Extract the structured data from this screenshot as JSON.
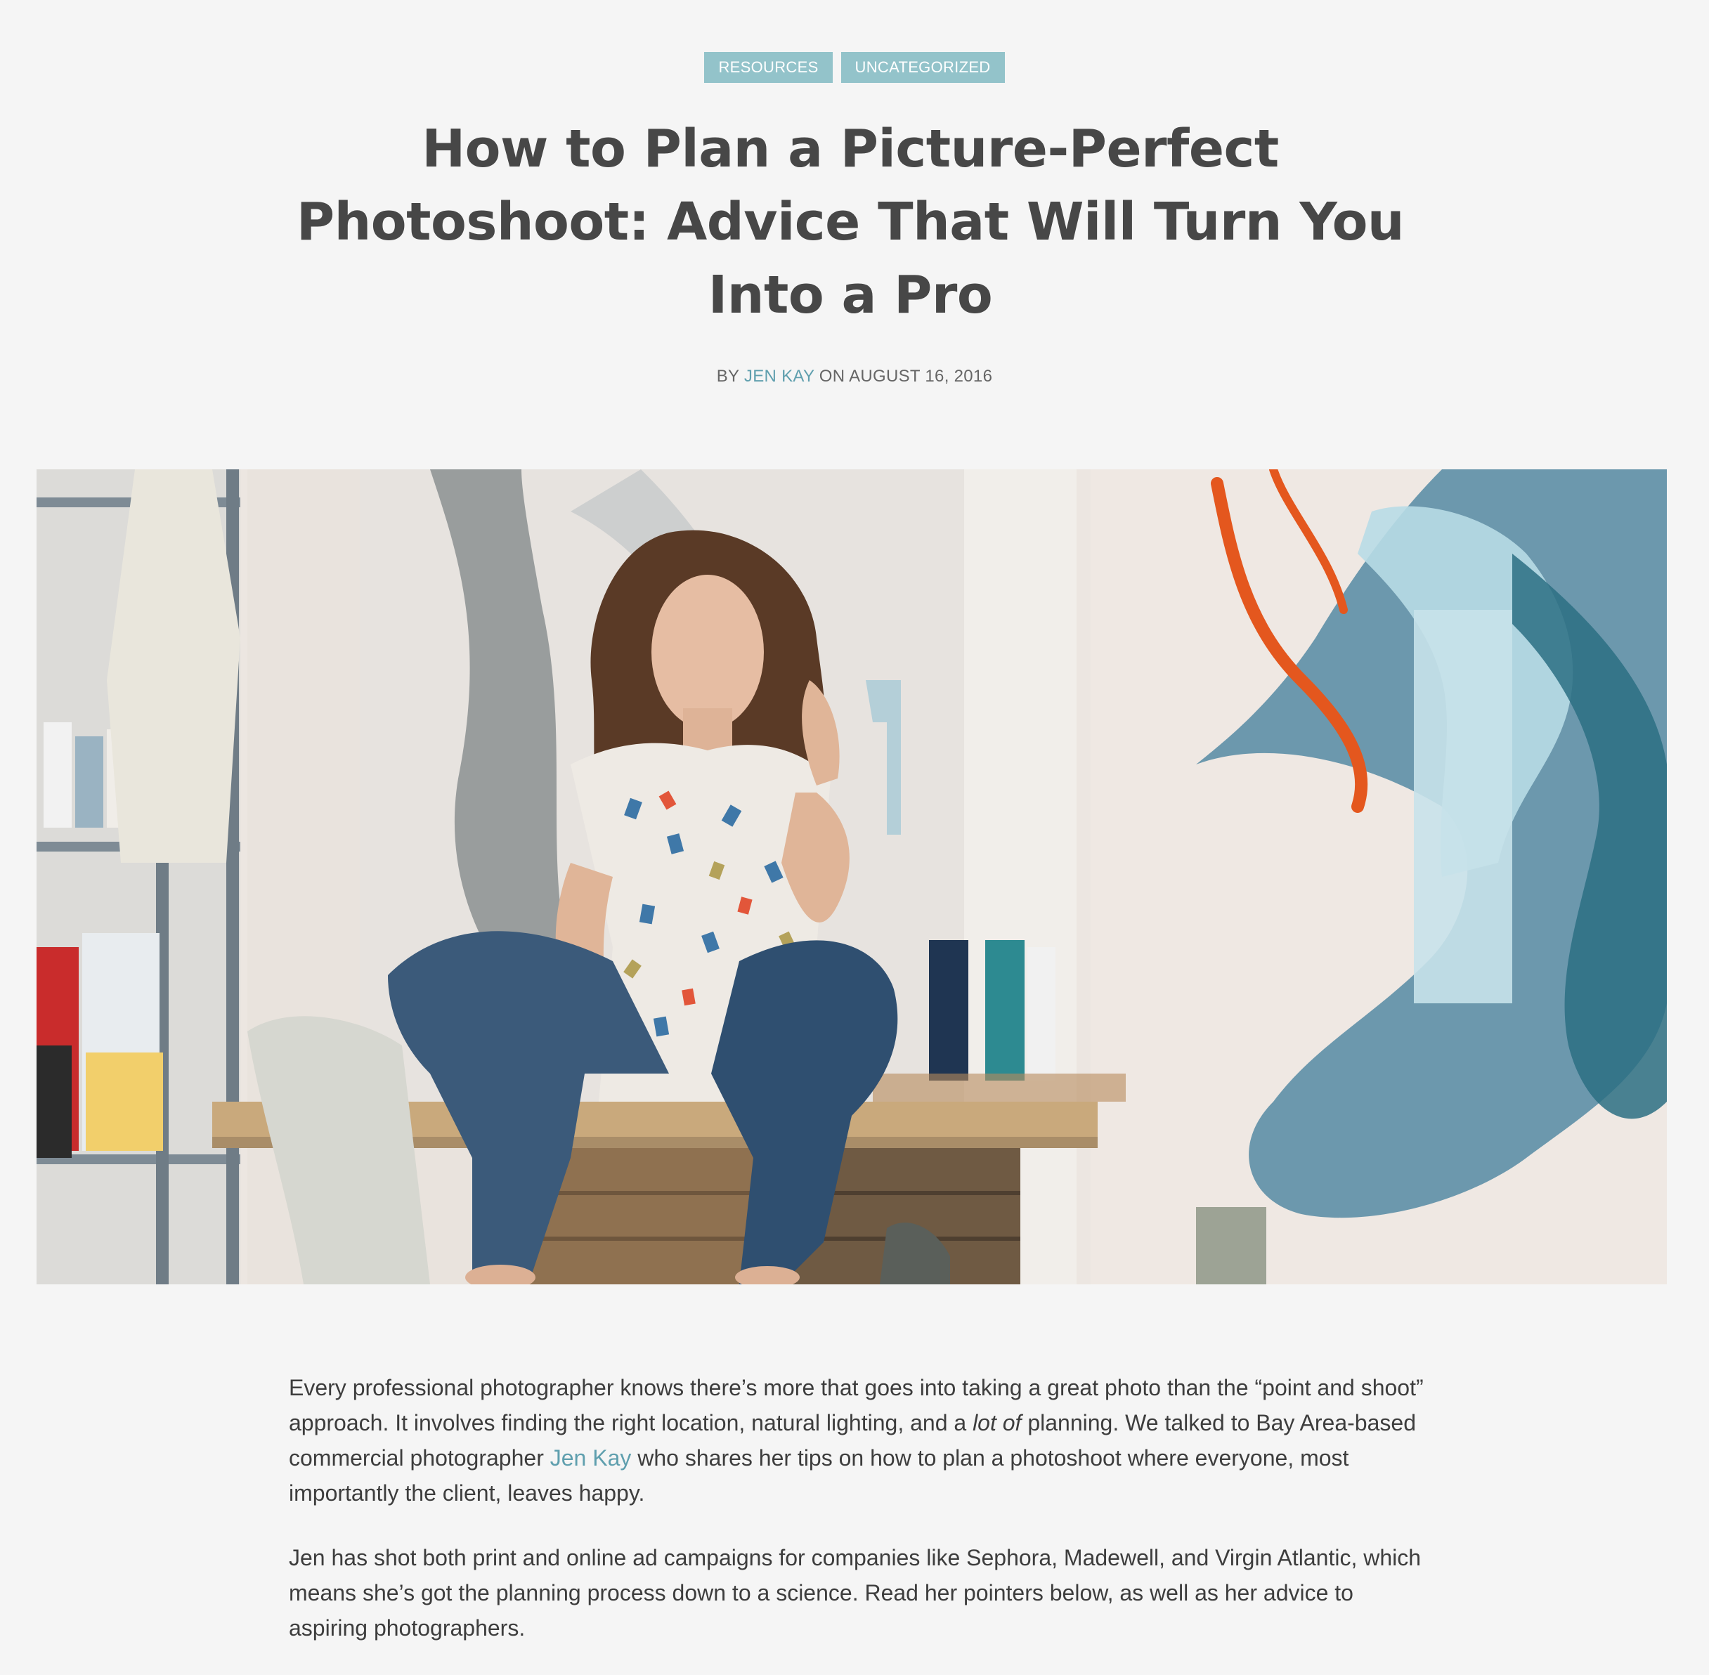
{
  "categories": [
    {
      "label": "RESOURCES"
    },
    {
      "label": "UNCATEGORIZED"
    }
  ],
  "post": {
    "title": "How to Plan a Picture-Perfect Photoshoot: Advice That Will Turn You Into a Pro",
    "byline": {
      "prefix": "BY",
      "author": "JEN KAY",
      "on": "ON",
      "date": "AUGUST 16, 2016"
    },
    "hero_image": {
      "alt": ""
    },
    "paragraphs": {
      "p1": {
        "t1": "Every professional photographer knows there’s more that goes into taking a great photo than the “point and shoot” approach. It involves finding the right location, natural lighting, and a ",
        "em": "lot of",
        "t2": " planning. We talked to Bay Area-based commercial photographer ",
        "link": "Jen Kay",
        "t3": " who shares her tips on how to plan a photoshoot where everyone, most importantly the client, leaves happy."
      },
      "p2": "Jen has shot both print and online ad campaigns for companies like Sephora, Madewell, and Virgin Atlantic, which means she’s got the planning process down to a science. Read her pointers below, as well as her advice to aspiring photographers."
    }
  },
  "colors": {
    "background": "#f5f5f5",
    "tag_bg": "#93c3ca",
    "link": "#5f9fae",
    "title": "#474747"
  }
}
